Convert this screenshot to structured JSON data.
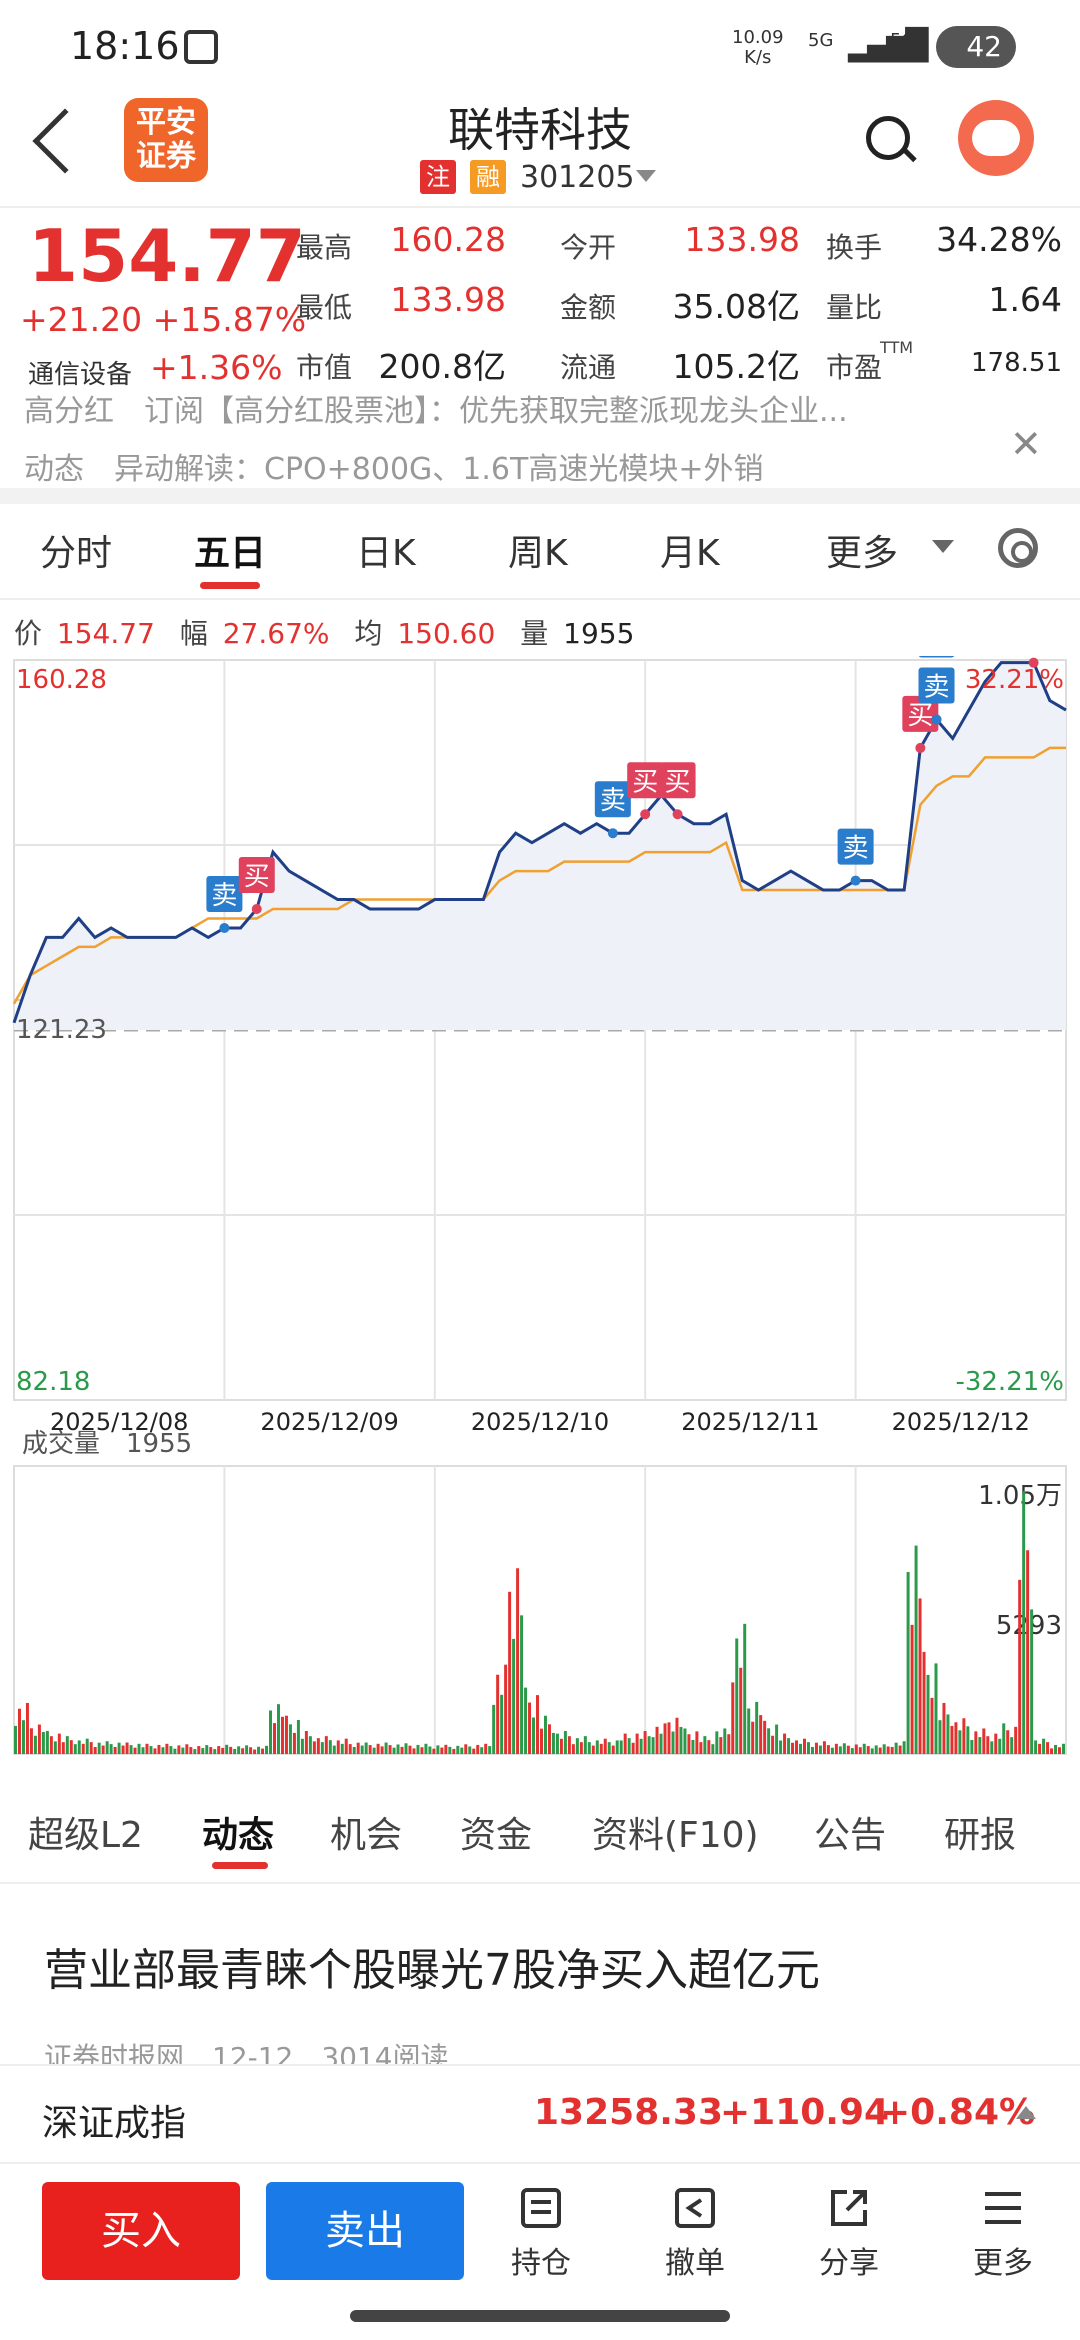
{
  "status_bar": {
    "time": "18:16",
    "speed_value": "10.09",
    "speed_unit": "K/s",
    "net1": "5G",
    "net2": "5G",
    "battery": "42"
  },
  "header": {
    "logo_line1": "平安",
    "logo_line2": "证券",
    "stock_name": "联特科技",
    "tag1": "注",
    "tag2": "融",
    "stock_code": "301205",
    "colors": {
      "logo": "#f0652a",
      "tag1": "#e2312f",
      "tag2": "#f59a23"
    }
  },
  "quote": {
    "price": "154.77",
    "change": "+21.20",
    "change_pct": "+15.87%",
    "industry": "通信设备",
    "industry_change": "+1.36%",
    "stats": [
      {
        "label": "最高",
        "value": "160.28",
        "color": "red"
      },
      {
        "label": "今开",
        "value": "133.98",
        "color": "red"
      },
      {
        "label": "换手",
        "value": "34.28%",
        "color": "dark"
      },
      {
        "label": "最低",
        "value": "133.98",
        "color": "red"
      },
      {
        "label": "金额",
        "value": "35.08亿",
        "color": "dark"
      },
      {
        "label": "量比",
        "value": "1.64",
        "color": "dark"
      },
      {
        "label": "市值",
        "value": "200.8亿",
        "color": "dark"
      },
      {
        "label": "流通",
        "value": "105.2亿",
        "color": "dark"
      },
      {
        "label": "市盈",
        "value": "178.51",
        "color": "dark"
      }
    ],
    "pe_sup": "TTM"
  },
  "ticker": {
    "line1": "高分红　订阅【高分红股票池】：优先获取完整派现龙头企业...",
    "line2": "动态　异动解读：CPO+800G、1.6T高速光模块+外销"
  },
  "period_tabs": [
    "分时",
    "五日",
    "日K",
    "周K",
    "月K",
    "更多"
  ],
  "info_line": {
    "price_label": "价",
    "price": "154.77",
    "amp_label": "幅",
    "amp": "27.67%",
    "avg_label": "均",
    "avg": "150.60",
    "vol_label": "量",
    "vol": "1955"
  },
  "chart_data": {
    "type": "line",
    "title": "五日分时",
    "y_top": "160.28",
    "y_base": "121.23",
    "y_bottom": "82.18",
    "pct_top": "32.21%",
    "pct_bottom": "-32.21%",
    "ylim": [
      82.18,
      160.28
    ],
    "base": 121.23,
    "dates": [
      "2025/12/08",
      "2025/12/09",
      "2025/12/10",
      "2025/12/11",
      "2025/12/12"
    ],
    "series": [
      {
        "values": [
          122,
          127,
          131,
          131,
          133,
          131,
          132,
          131,
          131,
          131,
          131,
          132,
          131,
          132,
          132,
          134,
          140,
          138,
          137,
          136,
          135,
          135,
          134,
          134,
          134,
          134,
          135,
          135,
          135,
          135,
          140,
          142,
          141,
          142,
          143,
          142,
          143,
          142,
          142,
          144,
          146,
          144,
          143,
          143,
          144,
          137,
          136,
          137,
          138,
          137,
          136,
          136,
          137,
          137,
          136,
          136,
          151,
          154,
          152,
          155,
          158,
          160,
          160,
          160,
          156,
          155
        ]
      },
      {
        "values": [
          124,
          127,
          128,
          129,
          130,
          130,
          131,
          131,
          131,
          131,
          131,
          132,
          133,
          133,
          133,
          133,
          134,
          134,
          134,
          134,
          134,
          135,
          135,
          135,
          135,
          135,
          135,
          135,
          135,
          135,
          137,
          138,
          138,
          138,
          139,
          139,
          139,
          139,
          139,
          140,
          140,
          140,
          140,
          140,
          141,
          136,
          136,
          136,
          136,
          136,
          136,
          136,
          136,
          136,
          136,
          136,
          145,
          147,
          148,
          148,
          150,
          150,
          150,
          150,
          151,
          151
        ]
      }
    ],
    "marks": [
      {
        "label": "卖",
        "type": "sell",
        "pos": 0.2
      },
      {
        "label": "买",
        "type": "buy",
        "pos": 0.23
      },
      {
        "label": "卖",
        "type": "sell",
        "pos": 0.57
      },
      {
        "label": "买",
        "type": "buy",
        "pos": 0.6
      },
      {
        "label": "买",
        "type": "buy",
        "pos": 0.625
      },
      {
        "label": "卖",
        "type": "sell",
        "pos": 0.8
      },
      {
        "label": "买",
        "type": "buy",
        "pos": 0.86
      },
      {
        "label": "卖",
        "type": "sell",
        "pos": 0.875
      },
      {
        "label": "卖",
        "type": "sell",
        "pos": 0.875
      },
      {
        "label": "买",
        "type": "buy",
        "pos": 0.975
      }
    ],
    "volume": {
      "label": "成交量",
      "value": "1955",
      "max_label": "1.05万",
      "mid_label": "5293",
      "max": 10500,
      "bars": [
        2000,
        1300,
        900,
        700,
        600,
        500,
        500,
        450,
        400,
        400,
        380,
        350,
        350,
        360,
        340,
        320,
        2200,
        1500,
        900,
        700,
        600,
        500,
        450,
        450,
        420,
        400,
        380,
        360,
        380,
        400,
        3500,
        8200,
        2600,
        1500,
        900,
        700,
        600,
        600,
        800,
        900,
        1200,
        1600,
        1000,
        700,
        1000,
        5100,
        2300,
        1300,
        800,
        600,
        500,
        450,
        420,
        400,
        380,
        500,
        9200,
        4000,
        2000,
        1400,
        1000,
        900,
        1200,
        10300,
        600,
        400
      ]
    }
  },
  "lower_tabs": [
    "超级L2",
    "动态",
    "机会",
    "资金",
    "资料(F10)",
    "公告",
    "研报"
  ],
  "news": {
    "title": "营业部最青睐个股曝光7股净买入超亿元",
    "meta": "证券时报网　12-12　3014阅读"
  },
  "index_bar": {
    "name": "深证成指",
    "value": "13258.33",
    "change": "+110.94",
    "change_pct": "+0.84%"
  },
  "bottom_bar": {
    "buy": "买入",
    "sell": "卖出",
    "items": [
      "持仓",
      "撤单",
      "分享",
      "更多"
    ],
    "colors": {
      "buy": "#e8211f",
      "sell": "#1a7be8"
    }
  }
}
